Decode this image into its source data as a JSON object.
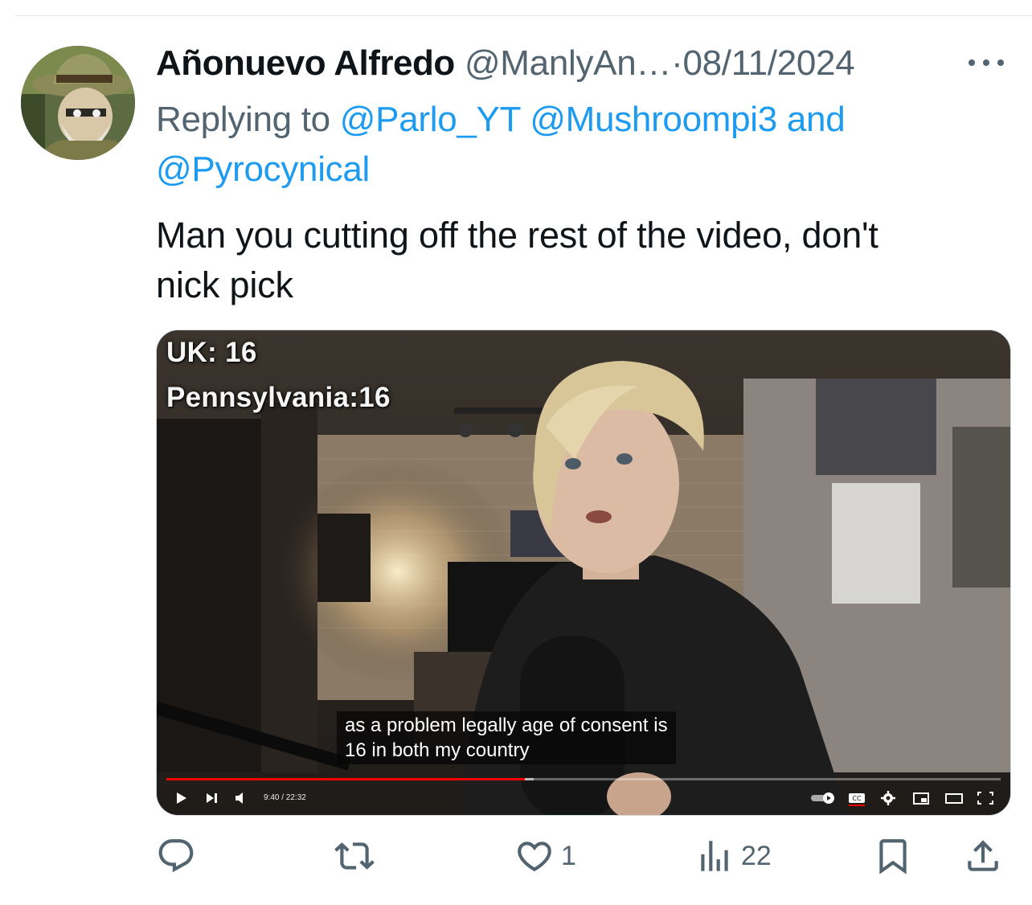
{
  "tweet": {
    "author": {
      "display_name": "Añonuevo Alfredo",
      "handle": "@ManlyAn…",
      "avatar_icon": "avatar-icon"
    },
    "separator": "·",
    "date": "08/11/2024",
    "replying_to": {
      "prefix": "Replying to",
      "mentions": [
        "@Parlo_YT",
        "@Mushroompi3",
        "@Pyrocynical"
      ],
      "conjunction": "and"
    },
    "text_line_1": "Man you cutting off the rest of the video, don't",
    "text_line_2": "nick pick",
    "media": {
      "overlay_line_1": "UK: 16",
      "overlay_line_2": "Pennsylvania:16",
      "caption_line_1": "as a problem legally age of consent is",
      "caption_line_2": "16 in both my country",
      "player": {
        "time": "9:40 / 22:32",
        "progress": 0.43
      }
    },
    "actions": {
      "reply": {
        "icon": "reply-icon",
        "count": ""
      },
      "repost": {
        "icon": "repost-icon",
        "count": ""
      },
      "like": {
        "icon": "heart-icon",
        "count": "1"
      },
      "views": {
        "icon": "views-icon",
        "count": "22"
      },
      "bookmark": {
        "icon": "bookmark-icon"
      },
      "share": {
        "icon": "share-icon"
      }
    }
  },
  "colors": {
    "accent": "#1d9bf0",
    "secondary_text": "#536471",
    "primary_text": "#0f1419",
    "progress_red": "#ff0000"
  }
}
